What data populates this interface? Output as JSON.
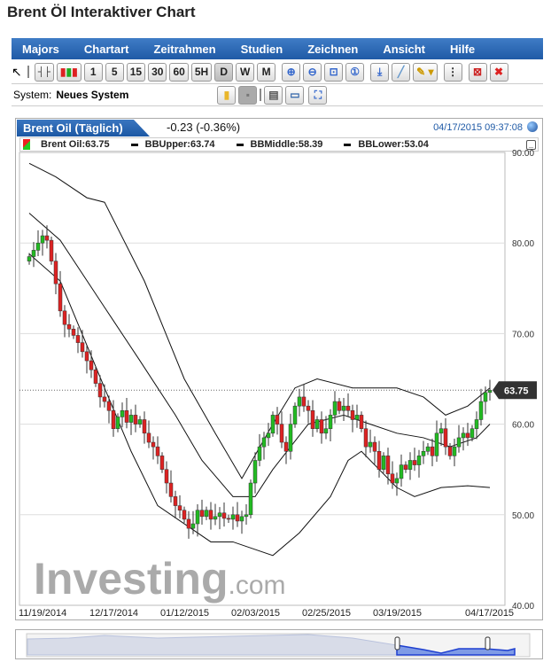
{
  "title": "Brent Öl Interaktiver Chart",
  "menu": [
    "Majors",
    "Chartart",
    "Zeitrahmen",
    "Studien",
    "Zeichnen",
    "Ansicht",
    "Hilfe"
  ],
  "timeframes": [
    "1",
    "5",
    "15",
    "30",
    "60",
    "5H",
    "D",
    "W",
    "M"
  ],
  "active_timeframe": "D",
  "system": {
    "label": "System:",
    "value": "Neues System"
  },
  "chart": {
    "tab": "Brent Oil (Täglich)",
    "change": "-0.23 (-0.36%)",
    "timestamp": "04/17/2015 09:37:08",
    "legend": {
      "price": "Brent Oil:63.75",
      "upper": "BBUpper:63.74",
      "middle": "BBMiddle:58.39",
      "lower": "BBLower:53.04"
    },
    "last_price": "63.75",
    "watermark": "Investing.com"
  },
  "colors": {
    "up": "#22bb22",
    "down": "#dd2222",
    "menu": "#2a66b2"
  },
  "chart_data": {
    "type": "candlestick",
    "ylim": [
      40,
      90
    ],
    "yticks": [
      "90.00",
      "80.00",
      "70.00",
      "60.00",
      "50.00",
      "40.00"
    ],
    "xticks": [
      {
        "label": "11/19/2014",
        "i": 4
      },
      {
        "label": "12/17/2014",
        "i": 20
      },
      {
        "label": "01/12/2015",
        "i": 36
      },
      {
        "label": "02/03/2015",
        "i": 52
      },
      {
        "label": "02/25/2015",
        "i": 68
      },
      {
        "label": "03/19/2015",
        "i": 84
      },
      {
        "label": "04/17/2015",
        "i": 104
      }
    ],
    "closes": [
      78.5,
      79.2,
      80.0,
      80.8,
      80.3,
      78.0,
      75.5,
      72.5,
      71.0,
      70.5,
      69.8,
      69.0,
      68.0,
      67.0,
      66.0,
      64.5,
      63.0,
      62.5,
      61.5,
      59.5,
      60.8,
      61.5,
      60.2,
      61.0,
      60.0,
      60.5,
      59.0,
      58.0,
      57.5,
      56.5,
      55.0,
      53.5,
      52.0,
      51.0,
      50.5,
      49.5,
      48.5,
      49.0,
      50.5,
      49.8,
      50.5,
      49.5,
      49.8,
      50.2,
      49.6,
      49.5,
      50.0,
      49.3,
      49.8,
      50.0,
      53.5,
      56.0,
      57.5,
      58.5,
      59.0,
      61.0,
      60.0,
      58.0,
      57.0,
      60.0,
      62.0,
      63.0,
      62.0,
      61.5,
      59.5,
      60.5,
      59.0,
      59.5,
      61.0,
      62.5,
      61.5,
      62.0,
      61.5,
      60.5,
      61.0,
      59.5,
      57.5,
      58.0,
      57.0,
      55.0,
      56.5,
      54.5,
      53.5,
      54.0,
      55.5,
      55.0,
      56.0,
      55.5,
      56.5,
      57.0,
      57.5,
      56.5,
      59.0,
      59.5,
      57.5,
      56.5,
      57.5,
      58.5,
      59.0,
      58.5,
      59.5,
      60.5,
      62.5,
      63.5,
      63.75
    ],
    "bb_upper": [
      [
        0,
        88.8
      ],
      [
        6,
        87.3
      ],
      [
        13,
        85
      ],
      [
        17,
        84.5
      ],
      [
        26,
        75.8
      ],
      [
        35,
        65
      ],
      [
        42,
        59
      ],
      [
        48,
        54
      ],
      [
        55,
        60
      ],
      [
        60,
        64
      ],
      [
        65,
        65
      ],
      [
        73,
        64
      ],
      [
        83,
        64
      ],
      [
        89,
        63
      ],
      [
        94,
        61
      ],
      [
        99,
        62
      ],
      [
        104,
        64
      ]
    ],
    "bb_middle": [
      [
        0,
        83.3
      ],
      [
        7,
        80.3
      ],
      [
        17,
        72.9
      ],
      [
        25,
        67
      ],
      [
        33,
        61
      ],
      [
        39,
        56
      ],
      [
        46,
        52
      ],
      [
        51,
        52
      ],
      [
        55,
        55
      ],
      [
        63,
        60
      ],
      [
        71,
        61
      ],
      [
        77,
        60
      ],
      [
        83,
        59
      ],
      [
        89,
        58.5
      ],
      [
        95,
        57.5
      ],
      [
        101,
        58.5
      ],
      [
        104,
        60
      ]
    ],
    "bb_lower": [
      [
        0,
        78.8
      ],
      [
        7,
        75.8
      ],
      [
        17,
        64
      ],
      [
        23,
        57
      ],
      [
        29,
        51
      ],
      [
        41,
        47
      ],
      [
        46,
        47
      ],
      [
        55,
        45.5
      ],
      [
        61,
        48
      ],
      [
        68,
        52
      ],
      [
        72,
        56
      ],
      [
        75,
        57
      ],
      [
        83,
        53
      ],
      [
        87,
        52
      ],
      [
        93,
        53
      ],
      [
        99,
        53.2
      ],
      [
        104,
        53
      ]
    ]
  }
}
